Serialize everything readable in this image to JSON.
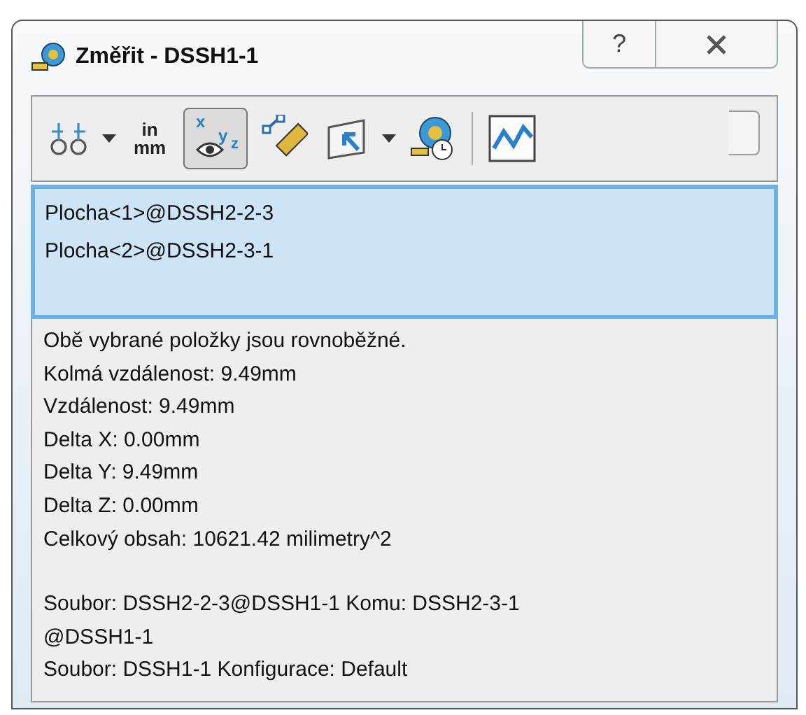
{
  "window": {
    "title": "Změřit - DSSH1-1",
    "help_glyph": "?"
  },
  "toolbar": [
    {
      "kind": "arc",
      "dropdown": true,
      "selected": false
    },
    {
      "kind": "units",
      "labels": [
        "in",
        "mm"
      ],
      "dropdown": false,
      "selected": false
    },
    {
      "kind": "xyz",
      "labels": [
        "x",
        "y",
        "z"
      ],
      "dropdown": false,
      "selected": true
    },
    {
      "kind": "ruler",
      "dropdown": false,
      "selected": false
    },
    {
      "kind": "pointer",
      "dropdown": true,
      "selected": false
    },
    {
      "kind": "history",
      "dropdown": false,
      "selected": false
    },
    {
      "kind": "separator"
    },
    {
      "kind": "graph",
      "dropdown": false,
      "selected": false
    }
  ],
  "selection_list": [
    "Plocha<1>@DSSH2-2-3",
    "Plocha<2>@DSSH2-3-1"
  ],
  "results": [
    "Obě vybrané položky jsou rovnoběžné.",
    "Kolmá vzdálenost: 9.49mm",
    "Vzdálenost: 9.49mm",
    "Delta X: 0.00mm",
    "Delta Y: 9.49mm",
    "Delta Z: 0.00mm",
    "Celkový obsah: 10621.42 milimetry^2"
  ],
  "files": [
    "Soubor: DSSH2-2-3@DSSH1-1 Komu: DSSH2-3-1",
    "@DSSH1-1",
    "Soubor: DSSH1-1 Konfigurace: Default"
  ]
}
